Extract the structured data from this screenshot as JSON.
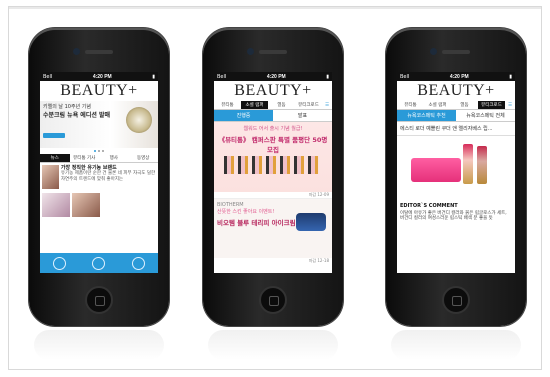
{
  "phones": [
    {
      "status": {
        "carrier": "Bell",
        "time": "4:20 PM"
      },
      "logo": {
        "text": "BEAUTY",
        "plus": "+"
      },
      "banner": {
        "line1": "키엘의 날 10주년 기념",
        "line2": "수분크림 뉴욕 에디션 발매"
      },
      "tabs": [
        "뉴스",
        "뷰티통 기사",
        "행사",
        "동영상"
      ],
      "news": [
        {
          "headline": "가장 정직한 유기농 브랜드",
          "body": "유기농 제품이란 순한 건 물론 네 피부 자극도 덜한 자연주의 트렌드에 맞춰 좋아지는"
        }
      ],
      "nav_icons": [
        "home-icon",
        "bag-icon",
        "tv-icon"
      ]
    },
    {
      "status": {
        "carrier": "Bell",
        "time": "4:20 PM"
      },
      "logo": {
        "text": "BEAUTY",
        "plus": "+"
      },
      "nav": [
        "뷰티통",
        "소셜 럼퍼",
        "열돔",
        "뷰티크로드"
      ],
      "tabs": [
        "진행중",
        "발표"
      ],
      "promo1": {
        "headline": "웹워드 어서 출시 기념 월급!",
        "title": "《뷰티통》 캠퍼스판 특별 품평단 50명 모집",
        "date": "마감 12-09"
      },
      "promo2": {
        "brand": "BIOTHERM",
        "headline": "산뜻한 스킨 좋아요 이벤트!",
        "title": "비오템 블루 테리피 아이크림",
        "date": "마감 12-18"
      }
    },
    {
      "status": {
        "carrier": "Bell",
        "time": "4:20 PM"
      },
      "logo": {
        "text": "BEAUTY",
        "plus": "+"
      },
      "nav": [
        "뷰티통",
        "소셜 럼퍼",
        "열돔",
        "뷰티크로드"
      ],
      "tabs": [
        "뉴욕코스메틱 추천",
        "뉴욕코스메틱 전체"
      ],
      "title": "에스티 로더 예쁠린 쿠더 앤 엘리자베스 립...",
      "editor": {
        "heading": "EDITOR`S COMMENT",
        "body": "이탈에 아유가 좋은 버건디 컬러와 붉은 립글로스가 세트, 버건디 컬러의 여성스러운 립스틱 배색 분 좋을 듯"
      }
    }
  ]
}
